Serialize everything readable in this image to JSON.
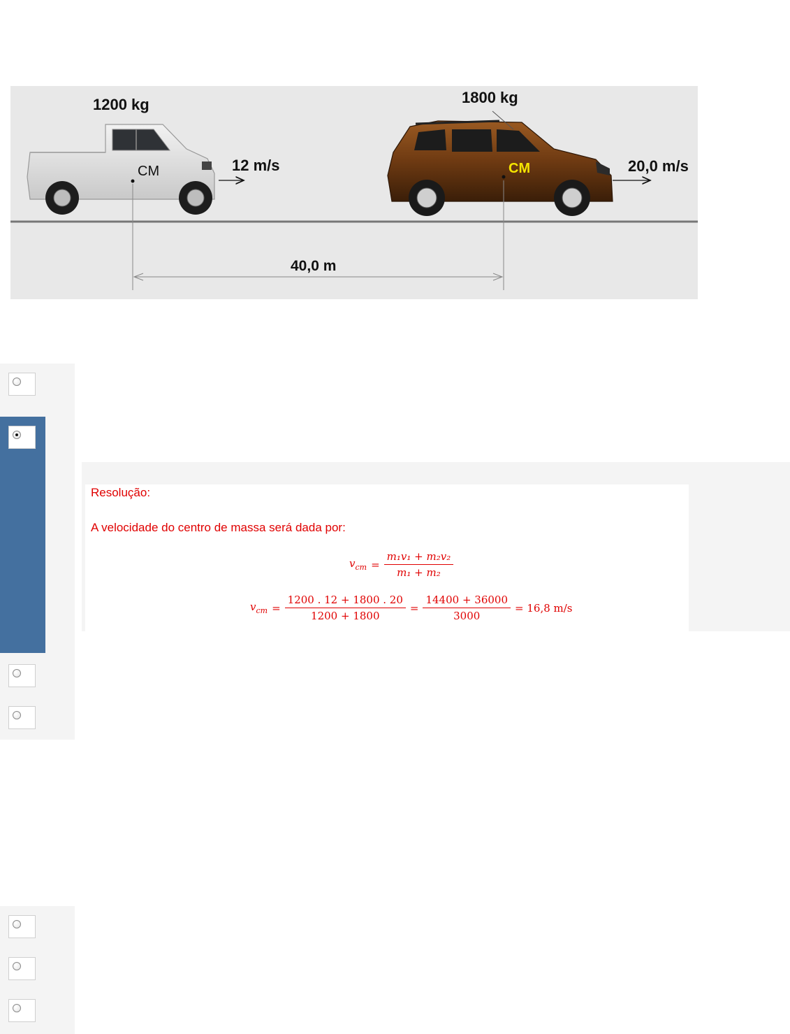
{
  "figure": {
    "pickup": {
      "mass": "1200 kg",
      "speed": "12 m/s",
      "cm": "CM"
    },
    "suv": {
      "mass": "1800 kg",
      "speed": "20,0 m/s",
      "cm": "CM"
    },
    "distance": "40,0 m"
  },
  "feedback": {
    "title": "Resolução:",
    "intro": "A velocidade do centro de massa será dada por:",
    "formula": {
      "lhs": "v",
      "lhs_sub": "cm",
      "equals": "=",
      "numerator": "m₁v₁ + m₂v₂",
      "denominator": "m₁ + m₂"
    },
    "calculation": {
      "lhs": "v",
      "lhs_sub": "cm",
      "equals": "=",
      "num1": "1200 . 12 + 1800 . 20",
      "den1": "1200 + 1800",
      "num2": "14400 + 36000",
      "den2": "3000",
      "result": "= 16,8 m/s"
    }
  },
  "options_group_1": [
    {
      "checked": false
    },
    {
      "checked": true
    },
    {
      "checked": false
    },
    {
      "checked": false
    }
  ],
  "options_group_2": [
    {
      "checked": false
    },
    {
      "checked": false
    },
    {
      "checked": false
    }
  ],
  "colors": {
    "selected_bar": "#44709f",
    "feedback_text": "#e00000",
    "suv_cm_label": "#f5e400"
  }
}
